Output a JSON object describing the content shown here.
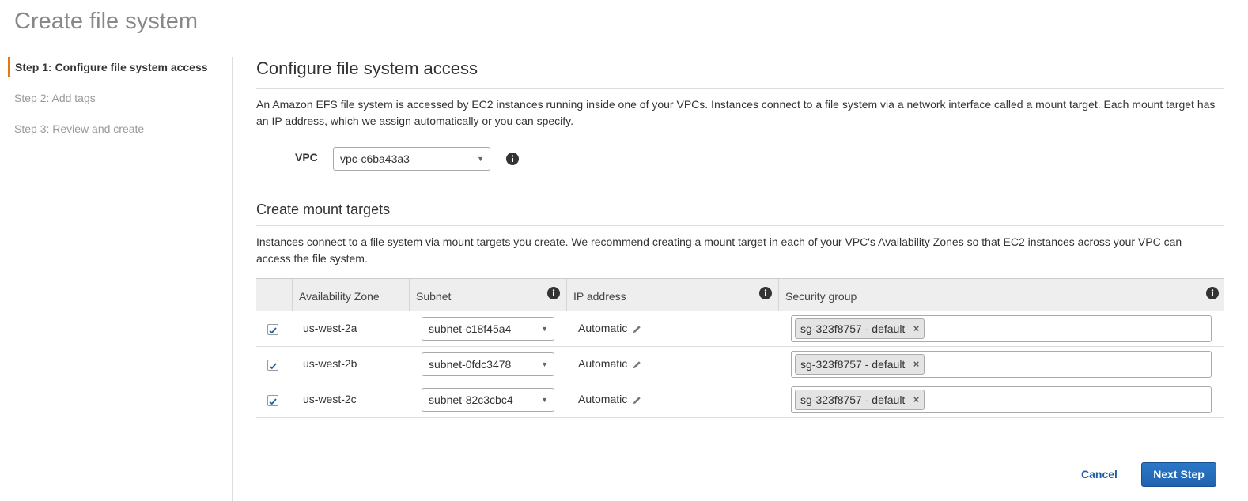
{
  "page": {
    "title": "Create file system"
  },
  "steps": [
    {
      "label": "Step 1: Configure file system access",
      "active": true
    },
    {
      "label": "Step 2: Add tags",
      "active": false
    },
    {
      "label": "Step 3: Review and create",
      "active": false
    }
  ],
  "configure": {
    "title": "Configure file system access",
    "description": "An Amazon EFS file system is accessed by EC2 instances running inside one of your VPCs. Instances connect to a file system via a network interface called a mount target. Each mount target has an IP address, which we assign automatically or you can specify.",
    "vpc_label": "VPC",
    "vpc_value": "vpc-c6ba43a3"
  },
  "mount_targets": {
    "title": "Create mount targets",
    "description": "Instances connect to a file system via mount targets you create. We recommend creating a mount target in each of your VPC's Availability Zones so that EC2 instances across your VPC can access the file system.",
    "columns": {
      "az": "Availability Zone",
      "subnet": "Subnet",
      "ip": "IP address",
      "sg": "Security group"
    },
    "rows": [
      {
        "checked": true,
        "az": "us-west-2a",
        "subnet": "subnet-c18f45a4",
        "ip": "Automatic",
        "sg": "sg-323f8757 - default"
      },
      {
        "checked": true,
        "az": "us-west-2b",
        "subnet": "subnet-0fdc3478",
        "ip": "Automatic",
        "sg": "sg-323f8757 - default"
      },
      {
        "checked": true,
        "az": "us-west-2c",
        "subnet": "subnet-82c3cbc4",
        "ip": "Automatic",
        "sg": "sg-323f8757 - default"
      }
    ]
  },
  "footer": {
    "cancel_label": "Cancel",
    "next_label": "Next Step"
  },
  "colors": {
    "accent": "#e47911",
    "primary_button": "#1f63b0",
    "link": "#1e5ea8",
    "checkmark": "#1f5fa8"
  },
  "icons": {
    "info": "info-icon",
    "edit": "pencil-icon",
    "dropdown": "caret-down-icon",
    "remove": "remove-icon",
    "checkbox": "checkbox-checked-icon"
  }
}
